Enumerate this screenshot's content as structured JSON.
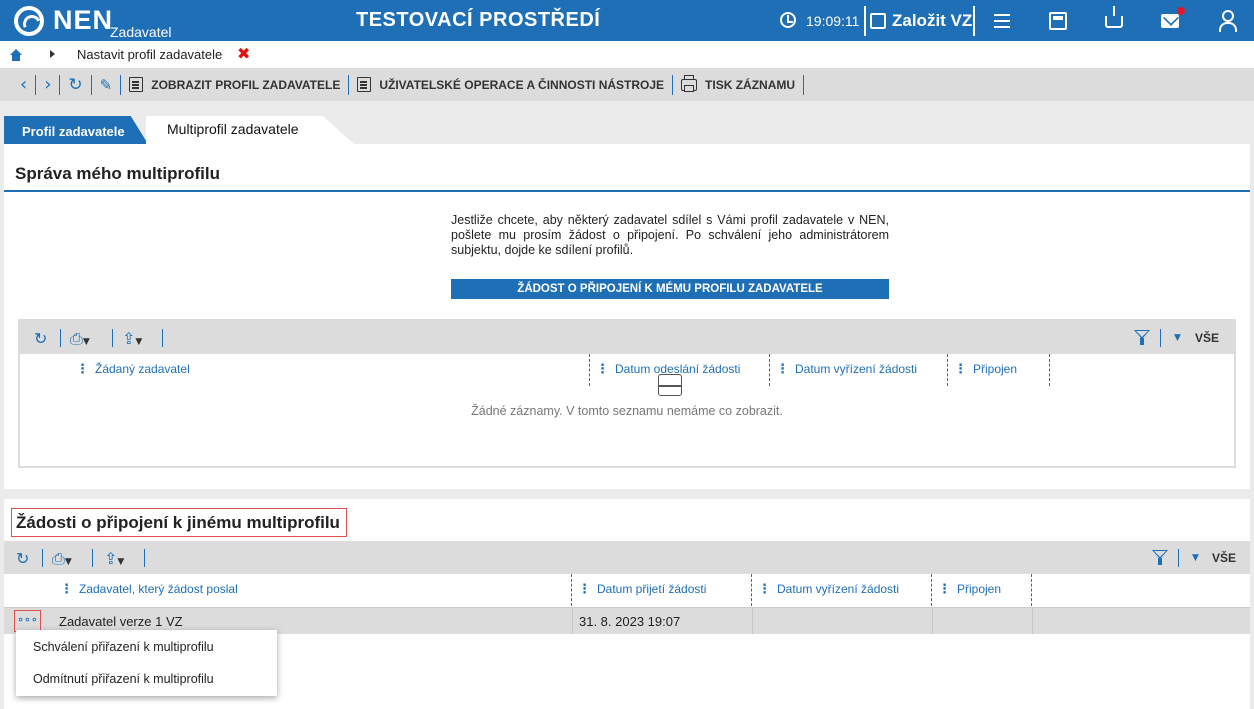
{
  "header": {
    "logo_text": "NEN",
    "logo_sub": "Zadavatel",
    "environment": "TESTOVACÍ PROSTŘEDÍ",
    "time": "19:09:11",
    "new_vz_label": "Založit VZ"
  },
  "breadcrumb": {
    "current": "Nastavit profil zadavatele",
    "close_glyph": "✖"
  },
  "toolbar": {
    "show_profile": "ZOBRAZIT PROFIL ZADAVATELE",
    "user_ops": "UŽIVATELSKÉ OPERACE A ČINNOSTI NÁSTROJE",
    "print_record": "TISK ZÁZNAMU"
  },
  "tabs": {
    "active": "Profil zadavatele",
    "inactive": "Multiprofil zadavatele"
  },
  "my_multiprofile": {
    "title": "Správa mého multiprofilu",
    "info_text": "Jestliže chcete, aby některý zadavatel sdílel s Vámi profil zadavatele v NEN, pošlete mu prosím žádost o připojení. Po schválení jeho administrátorem subjektu, dojde ke sdílení profilů.",
    "request_button": "ŽÁDOST O PŘIPOJENÍ K MÉMU PROFILU ZADAVATELE",
    "filter_all": "VŠE",
    "columns": [
      "Žádaný zadavatel",
      "Datum odeslání žádosti",
      "Datum vyřízení žádosti",
      "Připojen"
    ],
    "empty_text": "Žádné záznamy. V tomto seznamu nemáme co zobrazit."
  },
  "other_requests": {
    "title": "Žádosti o připojení k jinému multiprofilu",
    "filter_all": "VŠE",
    "columns": [
      "Zadavatel, který žádost poslal",
      "Datum přijetí žádosti",
      "Datum vyřízení žádosti",
      "Připojen"
    ],
    "rows": [
      {
        "sender": "Zadavatel verze 1 VZ",
        "received": "31. 8. 2023 19:07",
        "resolved": "",
        "connected": ""
      }
    ],
    "row_menu_glyph": "∘∘∘",
    "context_menu": [
      "Schválení přiřazení k multiprofilu",
      "Odmítnutí přiřazení k multiprofilu"
    ]
  },
  "colors": {
    "primary": "#1e6fb5",
    "notification": "#e0182d",
    "highlight_border": "#e05050"
  }
}
